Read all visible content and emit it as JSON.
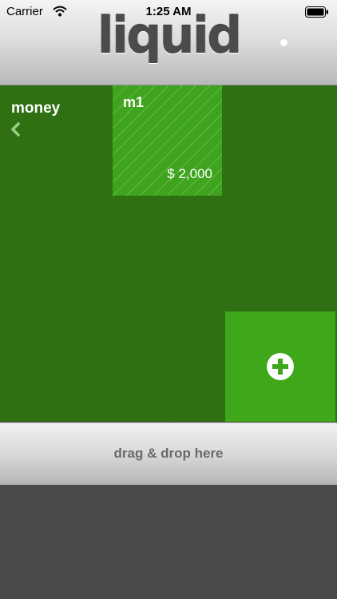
{
  "status_bar": {
    "carrier": "Carrier",
    "time": "1:25 AM"
  },
  "header": {
    "logo": "liquid"
  },
  "category": {
    "title": "money"
  },
  "tiles": [
    {
      "name": "m1",
      "amount": "$ 2,000"
    }
  ],
  "dropzone": {
    "label": "drag & drop here"
  },
  "colors": {
    "green_background": "#2f7012",
    "tile_green": "#3ea31d",
    "add_green": "#3fa81a",
    "footer_gray": "#4a4a4a"
  },
  "icons": [
    "wifi-icon",
    "battery-icon",
    "back-chevron-icon",
    "plus-icon"
  ]
}
